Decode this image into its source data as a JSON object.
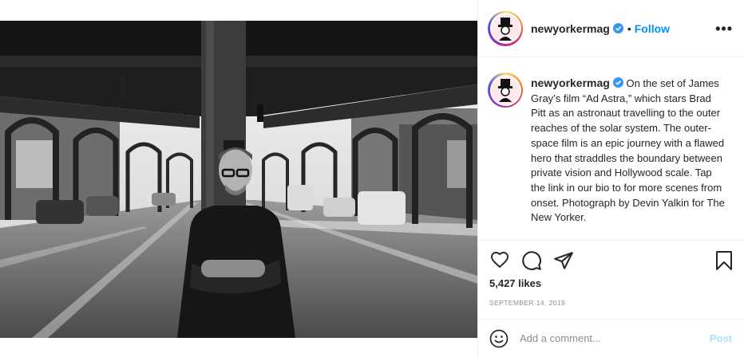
{
  "post": {
    "username": "newyorkermag",
    "follow_label": "Follow",
    "separator": "•",
    "more_label": "•••",
    "caption": "On the set of James Gray’s film “Ad Astra,” which stars Brad Pitt as an astronaut travelling to the outer reaches of the solar system. The outer-space film is an epic journey with a flawed hero that straddles the boundary between private vision and Hollywood scale. Tap the link in our bio to for more scenes from onset. Photograph by Devin Yalkin for The New Yorker.",
    "likes": "5,427 likes",
    "date": "September 14, 2019"
  },
  "comment": {
    "placeholder": "Add a comment...",
    "post_label": "Post"
  },
  "icons": {
    "like": "heart-icon",
    "comment": "comment-icon",
    "share": "paper-plane-icon",
    "save": "bookmark-icon",
    "emoji": "smiley-icon",
    "verified": "verified-badge-icon"
  },
  "colors": {
    "link_blue": "#0095f6",
    "post_disabled": "#b2dffc",
    "muted": "#8e8e8e",
    "border": "#efefef"
  }
}
